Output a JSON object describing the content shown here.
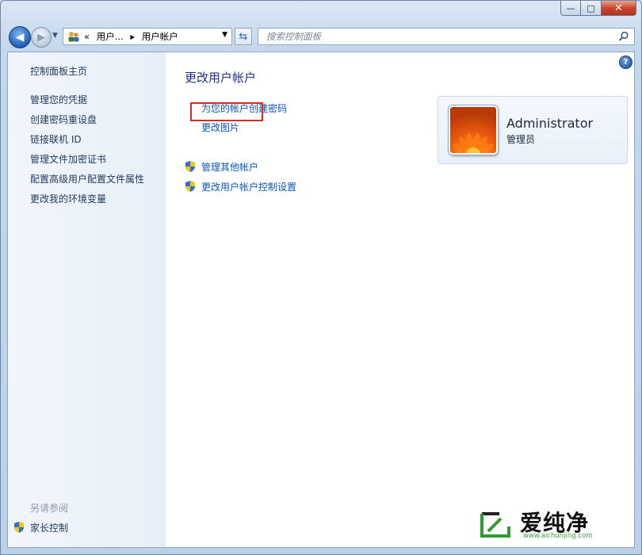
{
  "window": {
    "caption_min": "—",
    "caption_max": "□",
    "caption_close": "✕"
  },
  "navbar": {
    "back_icon": "back-arrow-icon",
    "forward_icon": "forward-arrow-icon",
    "address_icon": "user-accounts-icon",
    "breadcrumb_chevron": "«",
    "breadcrumb_parent": "用户...",
    "breadcrumb_sep": "▸",
    "breadcrumb_current": "用户帐户",
    "search_placeholder": "搜索控制面板"
  },
  "sidebar": {
    "home": "控制面板主页",
    "items": [
      "管理您的凭据",
      "创建密码重设盘",
      "链接联机 ID",
      "管理文件加密证书",
      "配置高级用户配置文件属性",
      "更改我的环境变量"
    ],
    "see_also_heading": "另请参阅",
    "see_also_items": [
      "家长控制"
    ]
  },
  "main": {
    "title": "更改用户帐户",
    "links": [
      "为您的帐户创建密码",
      "更改图片"
    ],
    "admin_links": [
      "管理其他帐户",
      "更改用户帐户控制设置"
    ],
    "help_label": "?"
  },
  "user": {
    "name": "Administrator",
    "role": "管理员"
  },
  "watermark": {
    "text": "爱纯净",
    "url": "www.aichunjing.com"
  },
  "colors": {
    "link": "#0b56bd",
    "title": "#1e3287",
    "highlight_box": "#d42b2b",
    "close_button": "#c9452d"
  }
}
